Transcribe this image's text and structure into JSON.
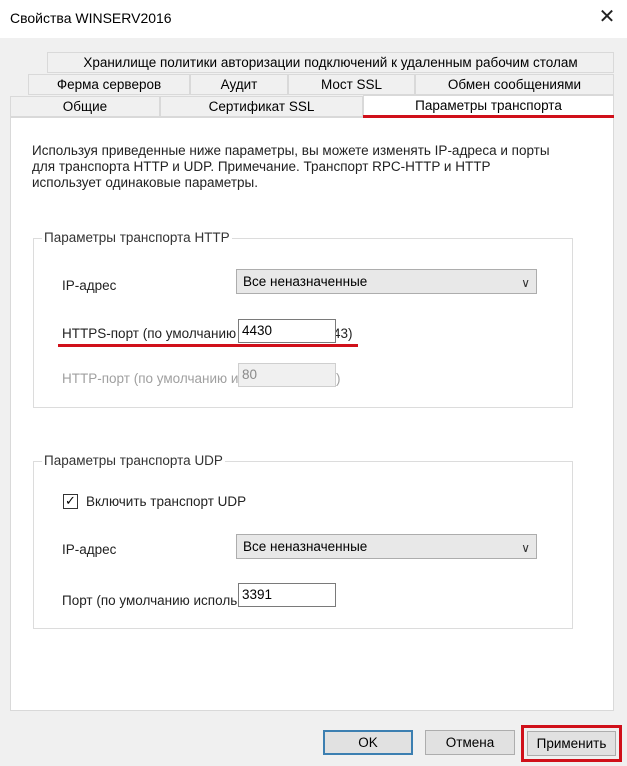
{
  "window": {
    "title": "Свойства WINSERV2016",
    "close_icon": "✕"
  },
  "tabs": {
    "row1": [
      "Хранилище политики авторизации подключений к удаленным рабочим столам"
    ],
    "row2": [
      "Ферма серверов",
      "Аудит",
      "Мост SSL",
      "Обмен сообщениями"
    ],
    "row3": [
      "Общие",
      "Сертификат SSL",
      "Параметры транспорта"
    ],
    "active": "Параметры транспорта"
  },
  "description": {
    "line1": "Используя приведенные ниже параметры, вы можете изменять IP-адреса и порты",
    "line2": "для транспорта HTTP и UDP. Примечание. Транспорт RPC-HTTP и HTTP",
    "line3": "использует одинаковые параметры."
  },
  "http_group": {
    "legend": "Параметры транспорта HTTP",
    "ip_label": "IP-адрес",
    "ip_value": "Все неназначенные",
    "https_label": "HTTPS-порт (по умолчанию",
    "https_value": "4430",
    "https_suffix": "43)",
    "http_label": "HTTP-порт (по умолчанию и",
    "http_value": "80",
    "http_suffix": ")"
  },
  "udp_group": {
    "legend": "Параметры транспорта UDP",
    "enable_label": "Включить транспорт UDP",
    "enable_checked": "✓",
    "ip_label": "IP-адрес",
    "ip_value": "Все неназначенные",
    "port_label": "Порт (по умолчанию исполь",
    "port_value": "3391"
  },
  "buttons": {
    "ok": "OK",
    "cancel": "Отмена",
    "apply": "Применить"
  },
  "colors": {
    "highlight": "#d0101a",
    "default_button_border": "#3c7fb1"
  }
}
